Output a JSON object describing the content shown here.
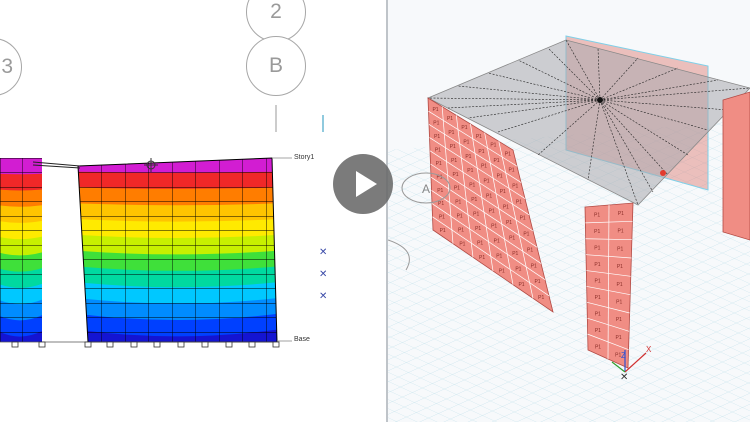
{
  "left_view": {
    "grid_bubbles": [
      {
        "label": "2"
      },
      {
        "label": "B"
      },
      {
        "label": "3"
      }
    ],
    "story_labels": {
      "top": "Story1",
      "bottom": "Base"
    },
    "contour_colors": [
      "#d21dd2",
      "#f02828",
      "#ff7d00",
      "#ffc400",
      "#ffea00",
      "#c7f000",
      "#3fe03a",
      "#00d9a0",
      "#00c8ff",
      "#008cff",
      "#0040ff",
      "#1414d2"
    ]
  },
  "right_view": {
    "grid_bubbles": [
      {
        "label": "A"
      }
    ],
    "wall_label": "P1",
    "wall_color": "#f08d84",
    "axes": {
      "x": "X",
      "z": "Z"
    }
  },
  "player": {
    "play_icon": "play-icon"
  }
}
